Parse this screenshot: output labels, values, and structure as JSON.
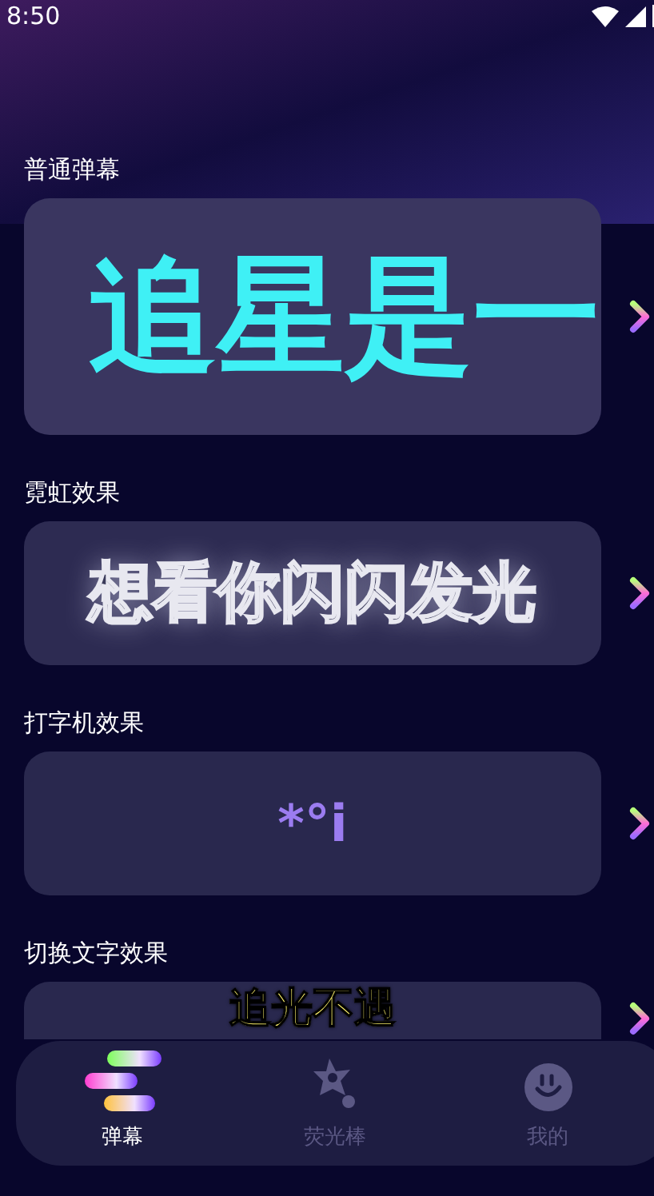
{
  "status_bar": {
    "time": "8:50"
  },
  "sections": [
    {
      "title": "普通弹幕",
      "kind": "plain",
      "preview": "追星是一"
    },
    {
      "title": "霓虹效果",
      "kind": "neon",
      "preview": "想看你闪闪发光"
    },
    {
      "title": "打字机效果",
      "kind": "typewriter",
      "preview": "*°i"
    },
    {
      "title": "切换文字效果",
      "kind": "switch",
      "preview": "追光不遇"
    }
  ],
  "nav": [
    {
      "label": "弹幕",
      "kind": "danmaku",
      "selected": true
    },
    {
      "label": "荧光棒",
      "kind": "glowstick",
      "selected": false
    },
    {
      "label": "我的",
      "kind": "profile",
      "selected": false
    }
  ]
}
